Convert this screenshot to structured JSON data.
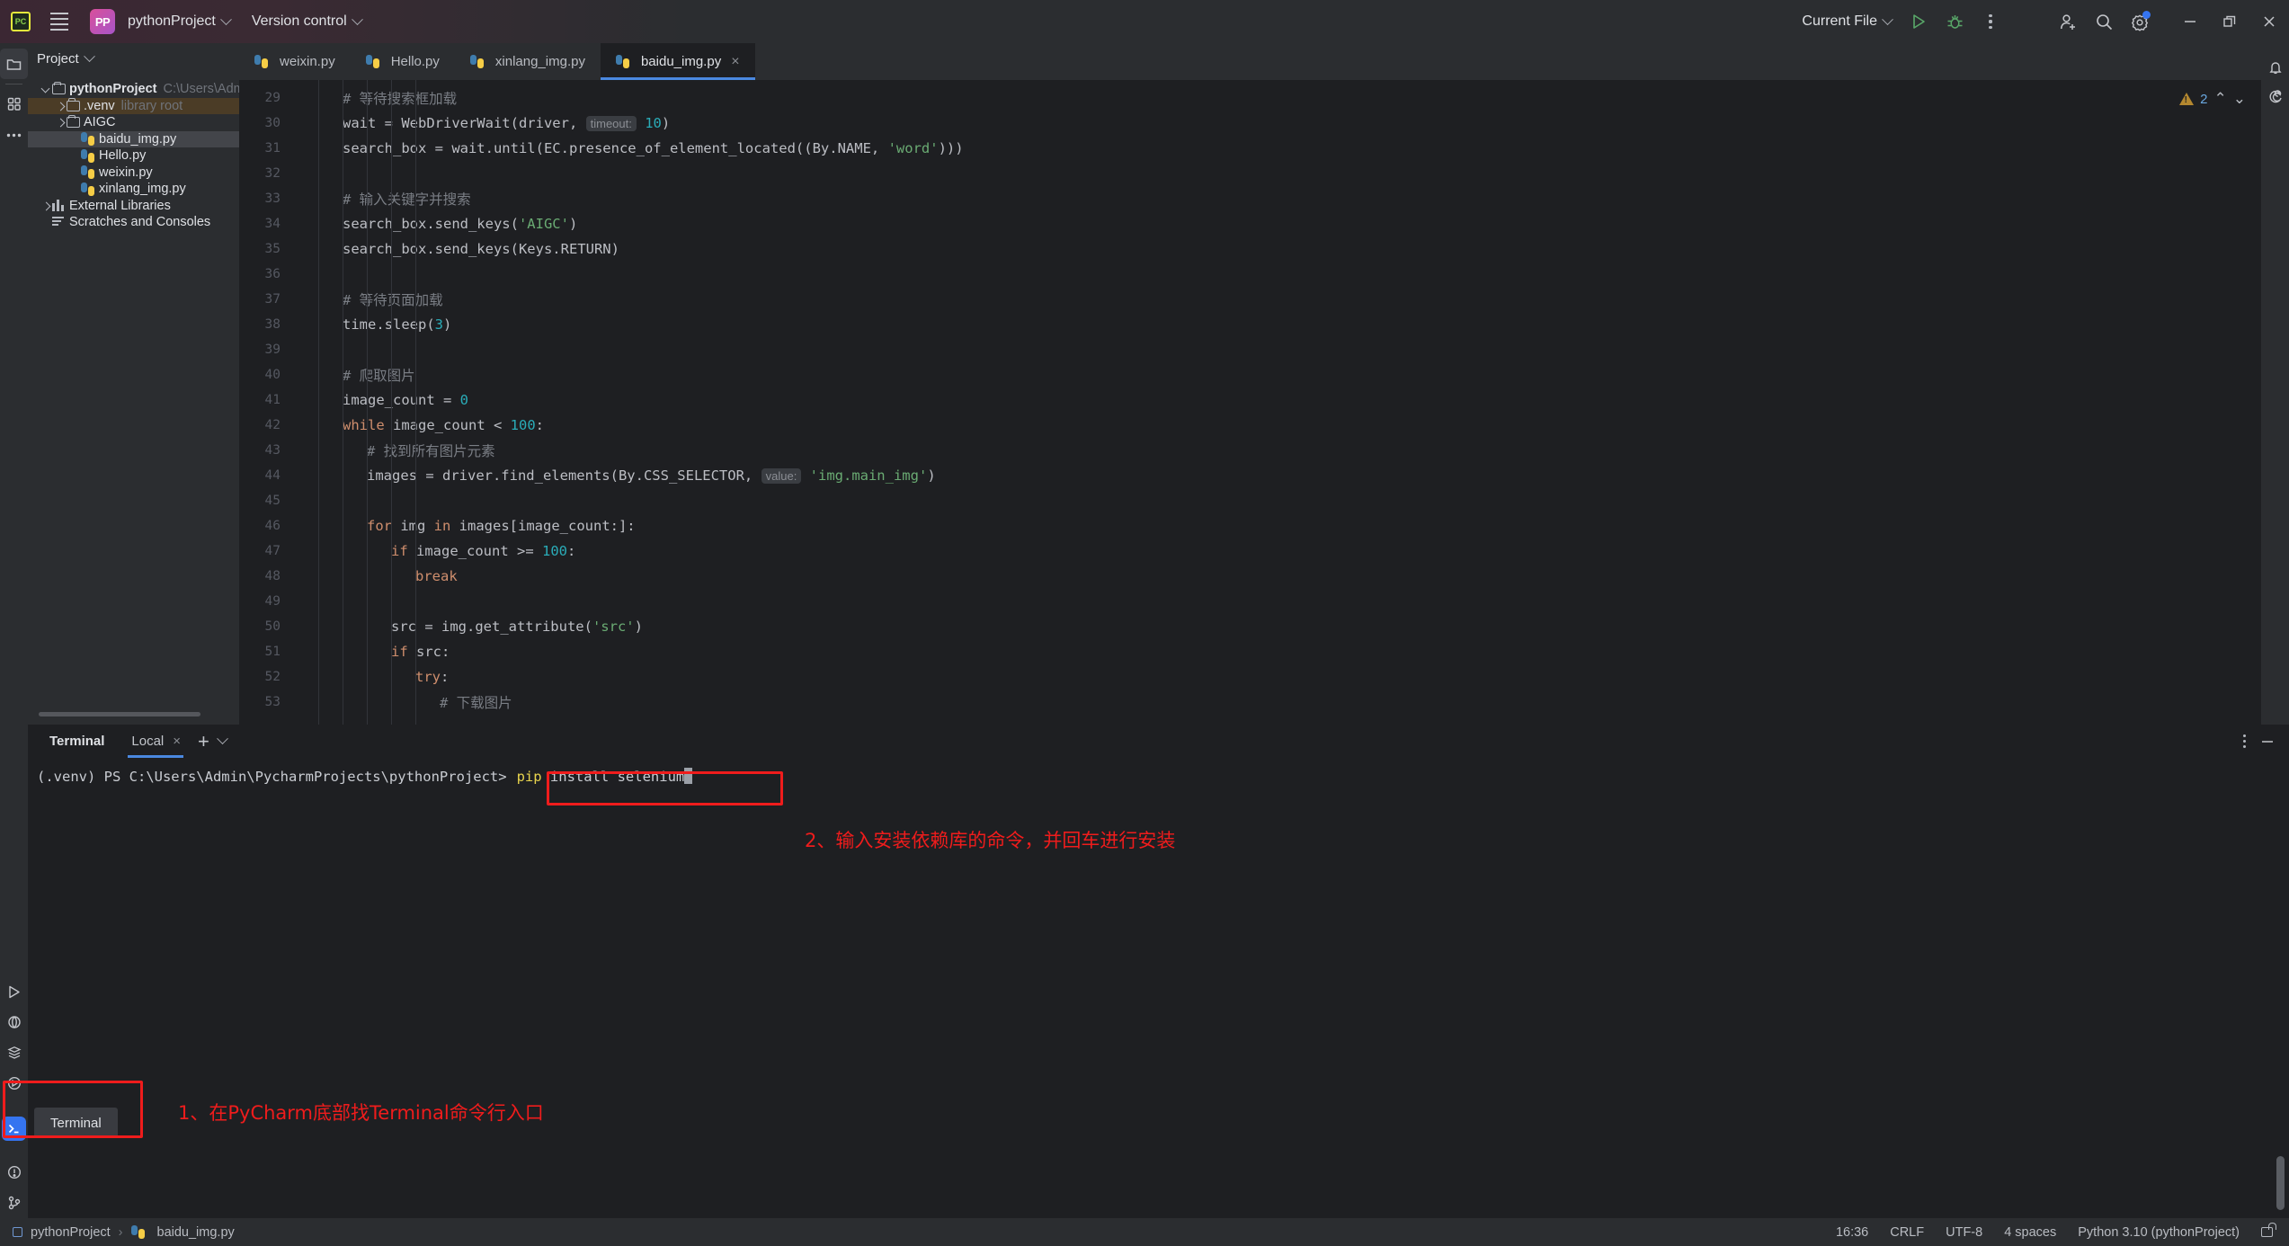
{
  "titlebar": {
    "app_icon": "pycharm-icon",
    "app_icon_text": "PC",
    "project_badge": "PP",
    "project_name": "pythonProject",
    "version_control": "Version control",
    "run_config": "Current File",
    "icons": [
      "run-icon",
      "debug-icon",
      "more-icon",
      "add-user-icon",
      "search-icon",
      "settings-icon"
    ],
    "window_controls": [
      "minimize",
      "restore",
      "close"
    ]
  },
  "project_panel": {
    "title": "Project",
    "tree": [
      {
        "label": "pythonProject",
        "suffix": "C:\\Users\\Admin\\PycharmPro",
        "icon": "folder-icon",
        "twisty": "open",
        "indent": 0,
        "bold": true,
        "state": "normal"
      },
      {
        "label": ".venv",
        "suffix": "library root",
        "icon": "folder-icon",
        "twisty": "closed",
        "indent": 1,
        "bold": false,
        "state": "highlight"
      },
      {
        "label": "AIGC",
        "suffix": "",
        "icon": "folder-icon",
        "twisty": "closed",
        "indent": 1,
        "bold": false,
        "state": "normal"
      },
      {
        "label": "baidu_img.py",
        "suffix": "",
        "icon": "python-icon",
        "twisty": "none",
        "indent": 2,
        "bold": false,
        "state": "selected"
      },
      {
        "label": "Hello.py",
        "suffix": "",
        "icon": "python-icon",
        "twisty": "none",
        "indent": 2,
        "bold": false,
        "state": "normal"
      },
      {
        "label": "weixin.py",
        "suffix": "",
        "icon": "python-icon",
        "twisty": "none",
        "indent": 2,
        "bold": false,
        "state": "normal"
      },
      {
        "label": "xinlang_img.py",
        "suffix": "",
        "icon": "python-icon",
        "twisty": "none",
        "indent": 2,
        "bold": false,
        "state": "normal"
      },
      {
        "label": "External Libraries",
        "suffix": "",
        "icon": "library-icon",
        "twisty": "closed",
        "indent": 0,
        "bold": false,
        "state": "normal"
      },
      {
        "label": "Scratches and Consoles",
        "suffix": "",
        "icon": "scratches-icon",
        "twisty": "none",
        "indent": 0,
        "bold": false,
        "state": "normal"
      }
    ]
  },
  "editor": {
    "tabs": [
      {
        "label": "weixin.py",
        "icon": "python-icon",
        "active": false,
        "closable": false
      },
      {
        "label": "Hello.py",
        "icon": "python-icon",
        "active": false,
        "closable": false
      },
      {
        "label": "xinlang_img.py",
        "icon": "python-icon",
        "active": false,
        "closable": false
      },
      {
        "label": "baidu_img.py",
        "icon": "python-icon",
        "active": true,
        "closable": true
      }
    ],
    "tab_close_glyph": "×",
    "inspection": {
      "warning_count": "2",
      "up_glyph": "⌃",
      "down_glyph": "⌄"
    },
    "lines": [
      {
        "num": "29",
        "indent": 1,
        "parts": [
          {
            "t": "# 等待搜索框加载",
            "c": "cm"
          }
        ]
      },
      {
        "num": "30",
        "indent": 1,
        "parts": [
          {
            "t": "wait = WebDriverWait(driver, ",
            "c": "ctext"
          },
          {
            "t": "timeout:",
            "c": "hint"
          },
          {
            "t": " ",
            "c": "ctext"
          },
          {
            "t": "10",
            "c": "n"
          },
          {
            "t": ")",
            "c": "ctext"
          }
        ]
      },
      {
        "num": "31",
        "indent": 1,
        "parts": [
          {
            "t": "search_box = wait.until(EC.presence_of_element_located((By.NAME, ",
            "c": "ctext"
          },
          {
            "t": "'word'",
            "c": "s"
          },
          {
            "t": ")))",
            "c": "ctext"
          }
        ]
      },
      {
        "num": "32",
        "indent": 1,
        "parts": []
      },
      {
        "num": "33",
        "indent": 1,
        "parts": [
          {
            "t": "# 输入关键字并搜索",
            "c": "cm"
          }
        ]
      },
      {
        "num": "34",
        "indent": 1,
        "parts": [
          {
            "t": "search_box.send_keys(",
            "c": "ctext"
          },
          {
            "t": "'AIGC'",
            "c": "s"
          },
          {
            "t": ")",
            "c": "ctext"
          }
        ]
      },
      {
        "num": "35",
        "indent": 1,
        "parts": [
          {
            "t": "search_box.send_keys(Keys.RETURN)",
            "c": "ctext"
          }
        ]
      },
      {
        "num": "36",
        "indent": 1,
        "parts": []
      },
      {
        "num": "37",
        "indent": 1,
        "parts": [
          {
            "t": "# 等待页面加载",
            "c": "cm"
          }
        ]
      },
      {
        "num": "38",
        "indent": 1,
        "parts": [
          {
            "t": "time.sleep(",
            "c": "ctext"
          },
          {
            "t": "3",
            "c": "n"
          },
          {
            "t": ")",
            "c": "ctext"
          }
        ]
      },
      {
        "num": "39",
        "indent": 1,
        "parts": []
      },
      {
        "num": "40",
        "indent": 1,
        "parts": [
          {
            "t": "# 爬取图片",
            "c": "cm"
          }
        ]
      },
      {
        "num": "41",
        "indent": 1,
        "parts": [
          {
            "t": "image_count = ",
            "c": "ctext"
          },
          {
            "t": "0",
            "c": "n"
          }
        ]
      },
      {
        "num": "42",
        "indent": 1,
        "parts": [
          {
            "t": "while",
            "c": "k"
          },
          {
            "t": " image_count < ",
            "c": "ctext"
          },
          {
            "t": "100",
            "c": "n"
          },
          {
            "t": ":",
            "c": "ctext"
          }
        ]
      },
      {
        "num": "43",
        "indent": 2,
        "parts": [
          {
            "t": "# 找到所有图片元素",
            "c": "cm"
          }
        ]
      },
      {
        "num": "44",
        "indent": 2,
        "parts": [
          {
            "t": "images = driver.find_elements(By.CSS_SELECTOR, ",
            "c": "ctext"
          },
          {
            "t": "value:",
            "c": "hint"
          },
          {
            "t": " ",
            "c": "ctext"
          },
          {
            "t": "'img.main_img'",
            "c": "s"
          },
          {
            "t": ")",
            "c": "ctext"
          }
        ]
      },
      {
        "num": "45",
        "indent": 2,
        "parts": []
      },
      {
        "num": "46",
        "indent": 2,
        "parts": [
          {
            "t": "for",
            "c": "k"
          },
          {
            "t": " img ",
            "c": "ctext"
          },
          {
            "t": "in",
            "c": "k"
          },
          {
            "t": " images[image_count:]:",
            "c": "ctext"
          }
        ]
      },
      {
        "num": "47",
        "indent": 3,
        "parts": [
          {
            "t": "if",
            "c": "k"
          },
          {
            "t": " image_count >= ",
            "c": "ctext"
          },
          {
            "t": "100",
            "c": "n"
          },
          {
            "t": ":",
            "c": "ctext"
          }
        ]
      },
      {
        "num": "48",
        "indent": 4,
        "parts": [
          {
            "t": "break",
            "c": "k"
          }
        ]
      },
      {
        "num": "49",
        "indent": 3,
        "parts": []
      },
      {
        "num": "50",
        "indent": 3,
        "parts": [
          {
            "t": "src = img.get_attribute(",
            "c": "ctext"
          },
          {
            "t": "'src'",
            "c": "s"
          },
          {
            "t": ")",
            "c": "ctext"
          }
        ]
      },
      {
        "num": "51",
        "indent": 3,
        "parts": [
          {
            "t": "if",
            "c": "k"
          },
          {
            "t": " src:",
            "c": "ctext"
          }
        ]
      },
      {
        "num": "52",
        "indent": 4,
        "parts": [
          {
            "t": "try",
            "c": "k"
          },
          {
            "t": ":",
            "c": "ctext"
          }
        ]
      },
      {
        "num": "53",
        "indent": 5,
        "parts": [
          {
            "t": "# 下载图片",
            "c": "cm"
          }
        ]
      }
    ]
  },
  "terminal": {
    "title": "Terminal",
    "tab_label": "Local",
    "tab_close_glyph": "×",
    "add_glyph": "+",
    "prompt": "(.venv) PS C:\\Users\\Admin\\PycharmProjects\\pythonProject",
    "prompt_sep": ">",
    "command_keyword": "pip",
    "command_rest": " install selenium",
    "tool_button": "Terminal"
  },
  "annotations": {
    "step1": "1、在PyCharm底部找Terminal命令行入口",
    "step2": "2、输入安装依赖库的命令，并回车进行安装",
    "color": "#ef1c1c"
  },
  "statusbar": {
    "breadcrumb_project": "pythonProject",
    "breadcrumb_sep": "›",
    "breadcrumb_file": "baidu_img.py",
    "caret": "16:36",
    "line_ending": "CRLF",
    "encoding": "UTF-8",
    "indent": "4 spaces",
    "interpreter": "Python 3.10 (pythonProject)",
    "lock": "lock-icon"
  },
  "colors": {
    "accent_blue": "#3574f0",
    "tab_underline": "#4a88e0",
    "annotation_red": "#ef1c1c",
    "panel_bg": "#2b2d30",
    "editor_bg": "#1e1f22"
  }
}
